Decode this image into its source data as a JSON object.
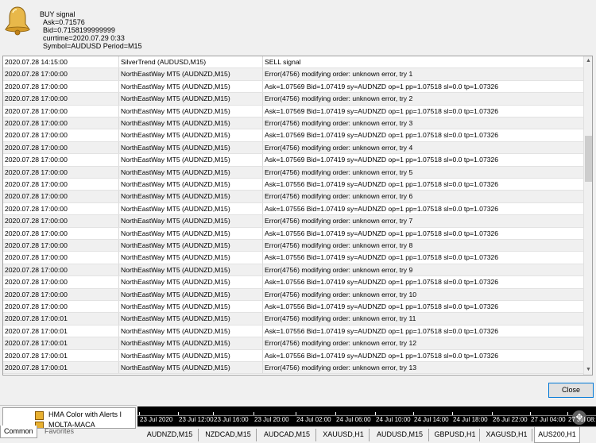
{
  "alert": {
    "line1": "BUY signal",
    "line2": "Ask=0.71576",
    "line3": "Bid=0.7158199999999",
    "line4": "currtime=2020.07.29 0:33",
    "line5": "Symbol=AUDUSD Period=M15"
  },
  "rows": [
    [
      "2020.07.28 14:15:00",
      "SilverTrend (AUDUSD,M15)",
      "SELL signal"
    ],
    [
      "2020.07.28 17:00:00",
      "NorthEastWay MT5 (AUDNZD,M15)",
      "Error(4756) modifying order: unknown error, try 1"
    ],
    [
      "2020.07.28 17:00:00",
      "NorthEastWay MT5 (AUDNZD,M15)",
      "Ask=1.07569  Bid=1.07419  sy=AUDNZD  op=1  pp=1.07518  sl=0.0  tp=1.07326"
    ],
    [
      "2020.07.28 17:00:00",
      "NorthEastWay MT5 (AUDNZD,M15)",
      "Error(4756) modifying order: unknown error, try 2"
    ],
    [
      "2020.07.28 17:00:00",
      "NorthEastWay MT5 (AUDNZD,M15)",
      "Ask=1.07569  Bid=1.07419  sy=AUDNZD  op=1  pp=1.07518  sl=0.0  tp=1.07326"
    ],
    [
      "2020.07.28 17:00:00",
      "NorthEastWay MT5 (AUDNZD,M15)",
      "Error(4756) modifying order: unknown error, try 3"
    ],
    [
      "2020.07.28 17:00:00",
      "NorthEastWay MT5 (AUDNZD,M15)",
      "Ask=1.07569  Bid=1.07419  sy=AUDNZD  op=1  pp=1.07518  sl=0.0  tp=1.07326"
    ],
    [
      "2020.07.28 17:00:00",
      "NorthEastWay MT5 (AUDNZD,M15)",
      "Error(4756) modifying order: unknown error, try 4"
    ],
    [
      "2020.07.28 17:00:00",
      "NorthEastWay MT5 (AUDNZD,M15)",
      "Ask=1.07569  Bid=1.07419  sy=AUDNZD  op=1  pp=1.07518  sl=0.0  tp=1.07326"
    ],
    [
      "2020.07.28 17:00:00",
      "NorthEastWay MT5 (AUDNZD,M15)",
      "Error(4756) modifying order: unknown error, try 5"
    ],
    [
      "2020.07.28 17:00:00",
      "NorthEastWay MT5 (AUDNZD,M15)",
      "Ask=1.07556  Bid=1.07419  sy=AUDNZD  op=1  pp=1.07518  sl=0.0  tp=1.07326"
    ],
    [
      "2020.07.28 17:00:00",
      "NorthEastWay MT5 (AUDNZD,M15)",
      "Error(4756) modifying order: unknown error, try 6"
    ],
    [
      "2020.07.28 17:00:00",
      "NorthEastWay MT5 (AUDNZD,M15)",
      "Ask=1.07556  Bid=1.07419  sy=AUDNZD  op=1  pp=1.07518  sl=0.0  tp=1.07326"
    ],
    [
      "2020.07.28 17:00:00",
      "NorthEastWay MT5 (AUDNZD,M15)",
      "Error(4756) modifying order: unknown error, try 7"
    ],
    [
      "2020.07.28 17:00:00",
      "NorthEastWay MT5 (AUDNZD,M15)",
      "Ask=1.07556  Bid=1.07419  sy=AUDNZD  op=1  pp=1.07518  sl=0.0  tp=1.07326"
    ],
    [
      "2020.07.28 17:00:00",
      "NorthEastWay MT5 (AUDNZD,M15)",
      "Error(4756) modifying order: unknown error, try 8"
    ],
    [
      "2020.07.28 17:00:00",
      "NorthEastWay MT5 (AUDNZD,M15)",
      "Ask=1.07556  Bid=1.07419  sy=AUDNZD  op=1  pp=1.07518  sl=0.0  tp=1.07326"
    ],
    [
      "2020.07.28 17:00:00",
      "NorthEastWay MT5 (AUDNZD,M15)",
      "Error(4756) modifying order: unknown error, try 9"
    ],
    [
      "2020.07.28 17:00:00",
      "NorthEastWay MT5 (AUDNZD,M15)",
      "Ask=1.07556  Bid=1.07419  sy=AUDNZD  op=1  pp=1.07518  sl=0.0  tp=1.07326"
    ],
    [
      "2020.07.28 17:00:00",
      "NorthEastWay MT5 (AUDNZD,M15)",
      "Error(4756) modifying order: unknown error, try 10"
    ],
    [
      "2020.07.28 17:00:00",
      "NorthEastWay MT5 (AUDNZD,M15)",
      "Ask=1.07556  Bid=1.07419  sy=AUDNZD  op=1  pp=1.07518  sl=0.0  tp=1.07326"
    ],
    [
      "2020.07.28 17:00:01",
      "NorthEastWay MT5 (AUDNZD,M15)",
      "Error(4756) modifying order: unknown error, try 11"
    ],
    [
      "2020.07.28 17:00:01",
      "NorthEastWay MT5 (AUDNZD,M15)",
      "Ask=1.07556  Bid=1.07419  sy=AUDNZD  op=1  pp=1.07518  sl=0.0  tp=1.07326"
    ],
    [
      "2020.07.28 17:00:01",
      "NorthEastWay MT5 (AUDNZD,M15)",
      "Error(4756) modifying order: unknown error, try 12"
    ],
    [
      "2020.07.28 17:00:01",
      "NorthEastWay MT5 (AUDNZD,M15)",
      "Ask=1.07556  Bid=1.07419  sy=AUDNZD  op=1  pp=1.07518  sl=0.0  tp=1.07326"
    ],
    [
      "2020.07.28 17:00:01",
      "NorthEastWay MT5 (AUDNZD,M15)",
      "Error(4756) modifying order: unknown error, try 13"
    ]
  ],
  "buttons": {
    "close": "Close"
  },
  "navigator": {
    "item1": "HMA Color with Alerts I",
    "item2": "MOLTA-MACA",
    "tab_common": "Common",
    "tab_favorites": "Favorites"
  },
  "timeline": [
    "23 Jul 2020",
    "23 Jul 12:00",
    "23 Jul 16:00",
    "23 Jul 20:00",
    "24 Jul 02:00",
    "24 Jul 06:00",
    "24 Jul 10:00",
    "24 Jul 14:00",
    "24 Jul 18:00",
    "26 Jul 22:00",
    "27 Jul 04:00",
    "27 Jul 08:"
  ],
  "symbol_tabs": [
    "AUDNZD,M15",
    "NZDCAD,M15",
    "AUDCAD,M15",
    "XAUUSD,H1",
    "AUDUSD,M15",
    "GBPUSD,H1",
    "XAGUSD,H1",
    "AUS200,H1"
  ],
  "active_symbol_tab": 7
}
